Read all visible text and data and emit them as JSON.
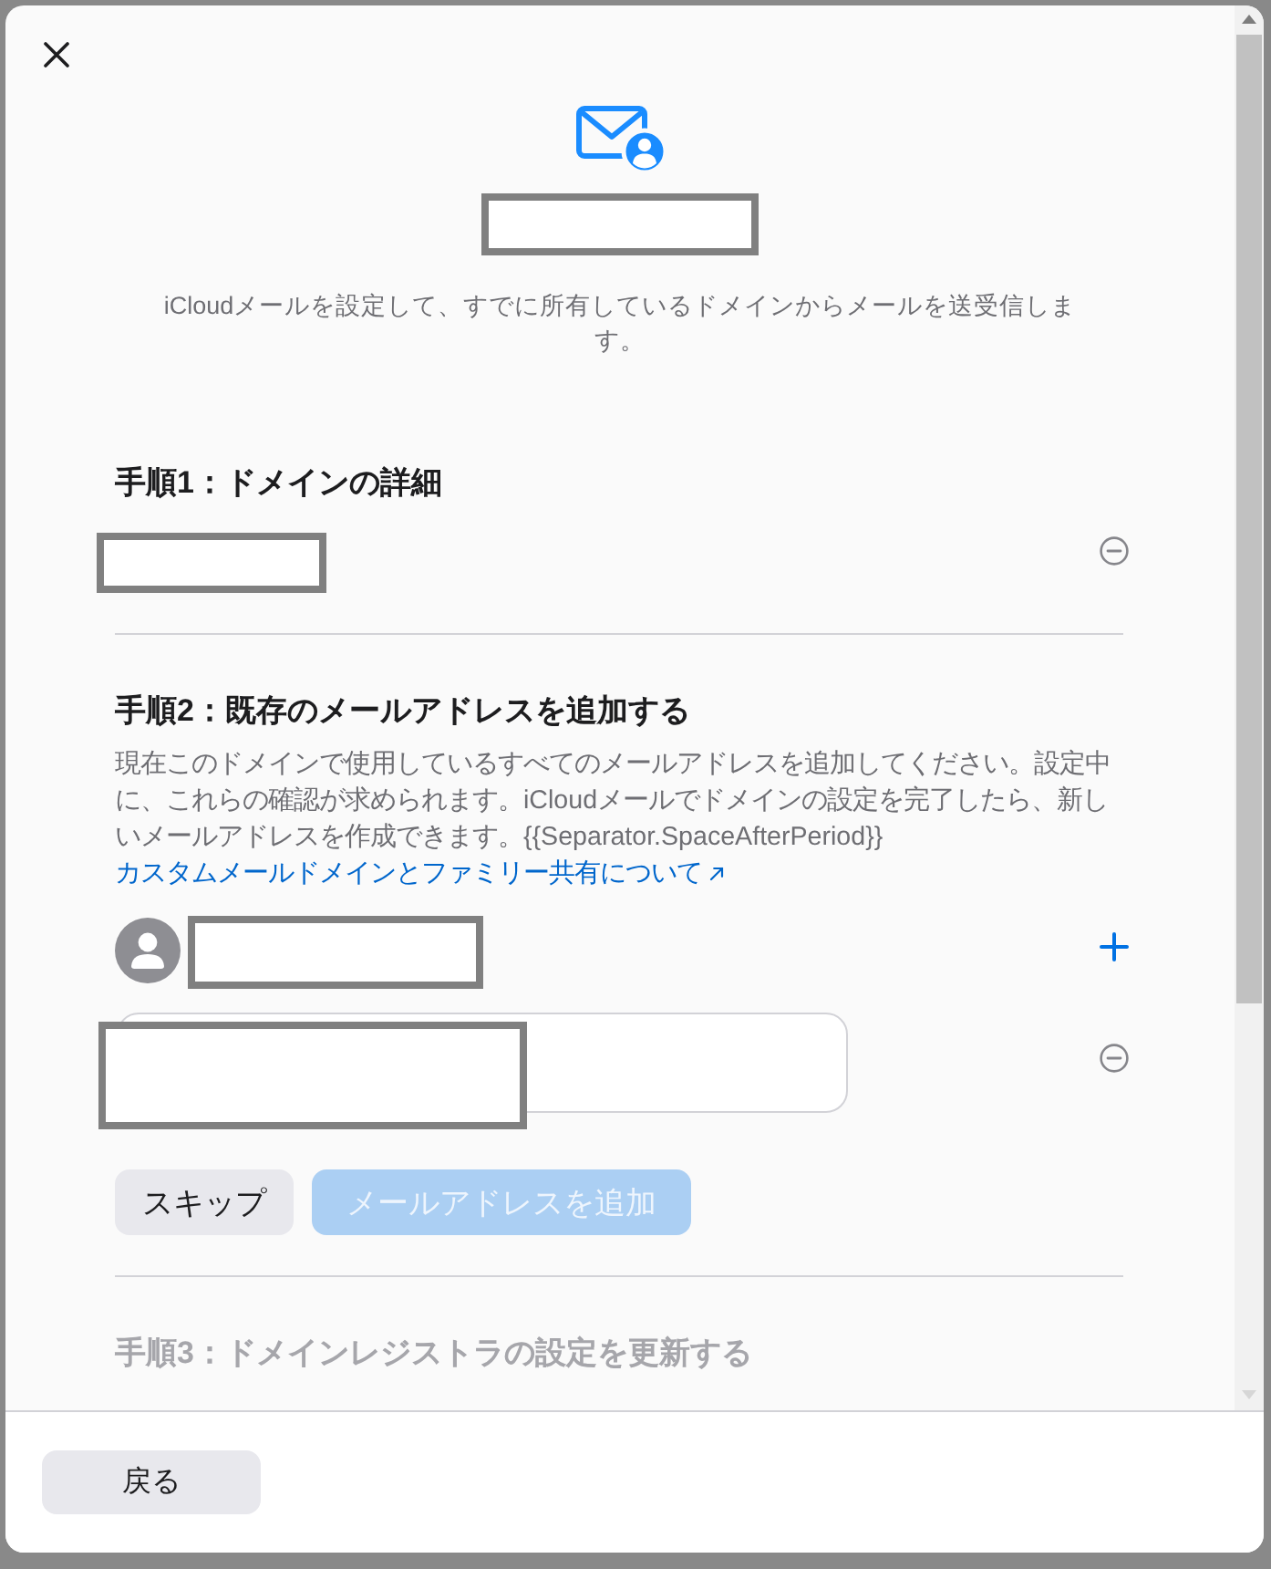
{
  "header": {
    "description": "iCloudメールを設定して、すでに所有しているドメインからメールを送受信します。"
  },
  "steps": [
    {
      "kind": "domain",
      "heading": "手順1：ドメインの詳細",
      "disabled": false
    },
    {
      "kind": "addresses",
      "heading": "手順2：既存のメールアドレスを追加する",
      "disabled": false,
      "description": "現在このドメインで使用しているすべてのメールアドレスを追加してください。設定中に、これらの確認が求められます。iCloudメールでドメインの設定を完了したら、新しいメールアドレスを作成できます。{{Separator.SpaceAfterPeriod}}",
      "link": "カスタムメールドメインとファミリー共有について",
      "buttons": [
        {
          "kind": "secondary",
          "label": "スキップ",
          "disabled": false
        },
        {
          "kind": "primary",
          "label": "メールアドレスを追加",
          "disabled": true
        }
      ]
    },
    {
      "kind": "registrar",
      "heading": "手順3：ドメインレジストラの設定を更新する",
      "disabled": true
    }
  ],
  "footer": {
    "back_button": "戻る"
  }
}
